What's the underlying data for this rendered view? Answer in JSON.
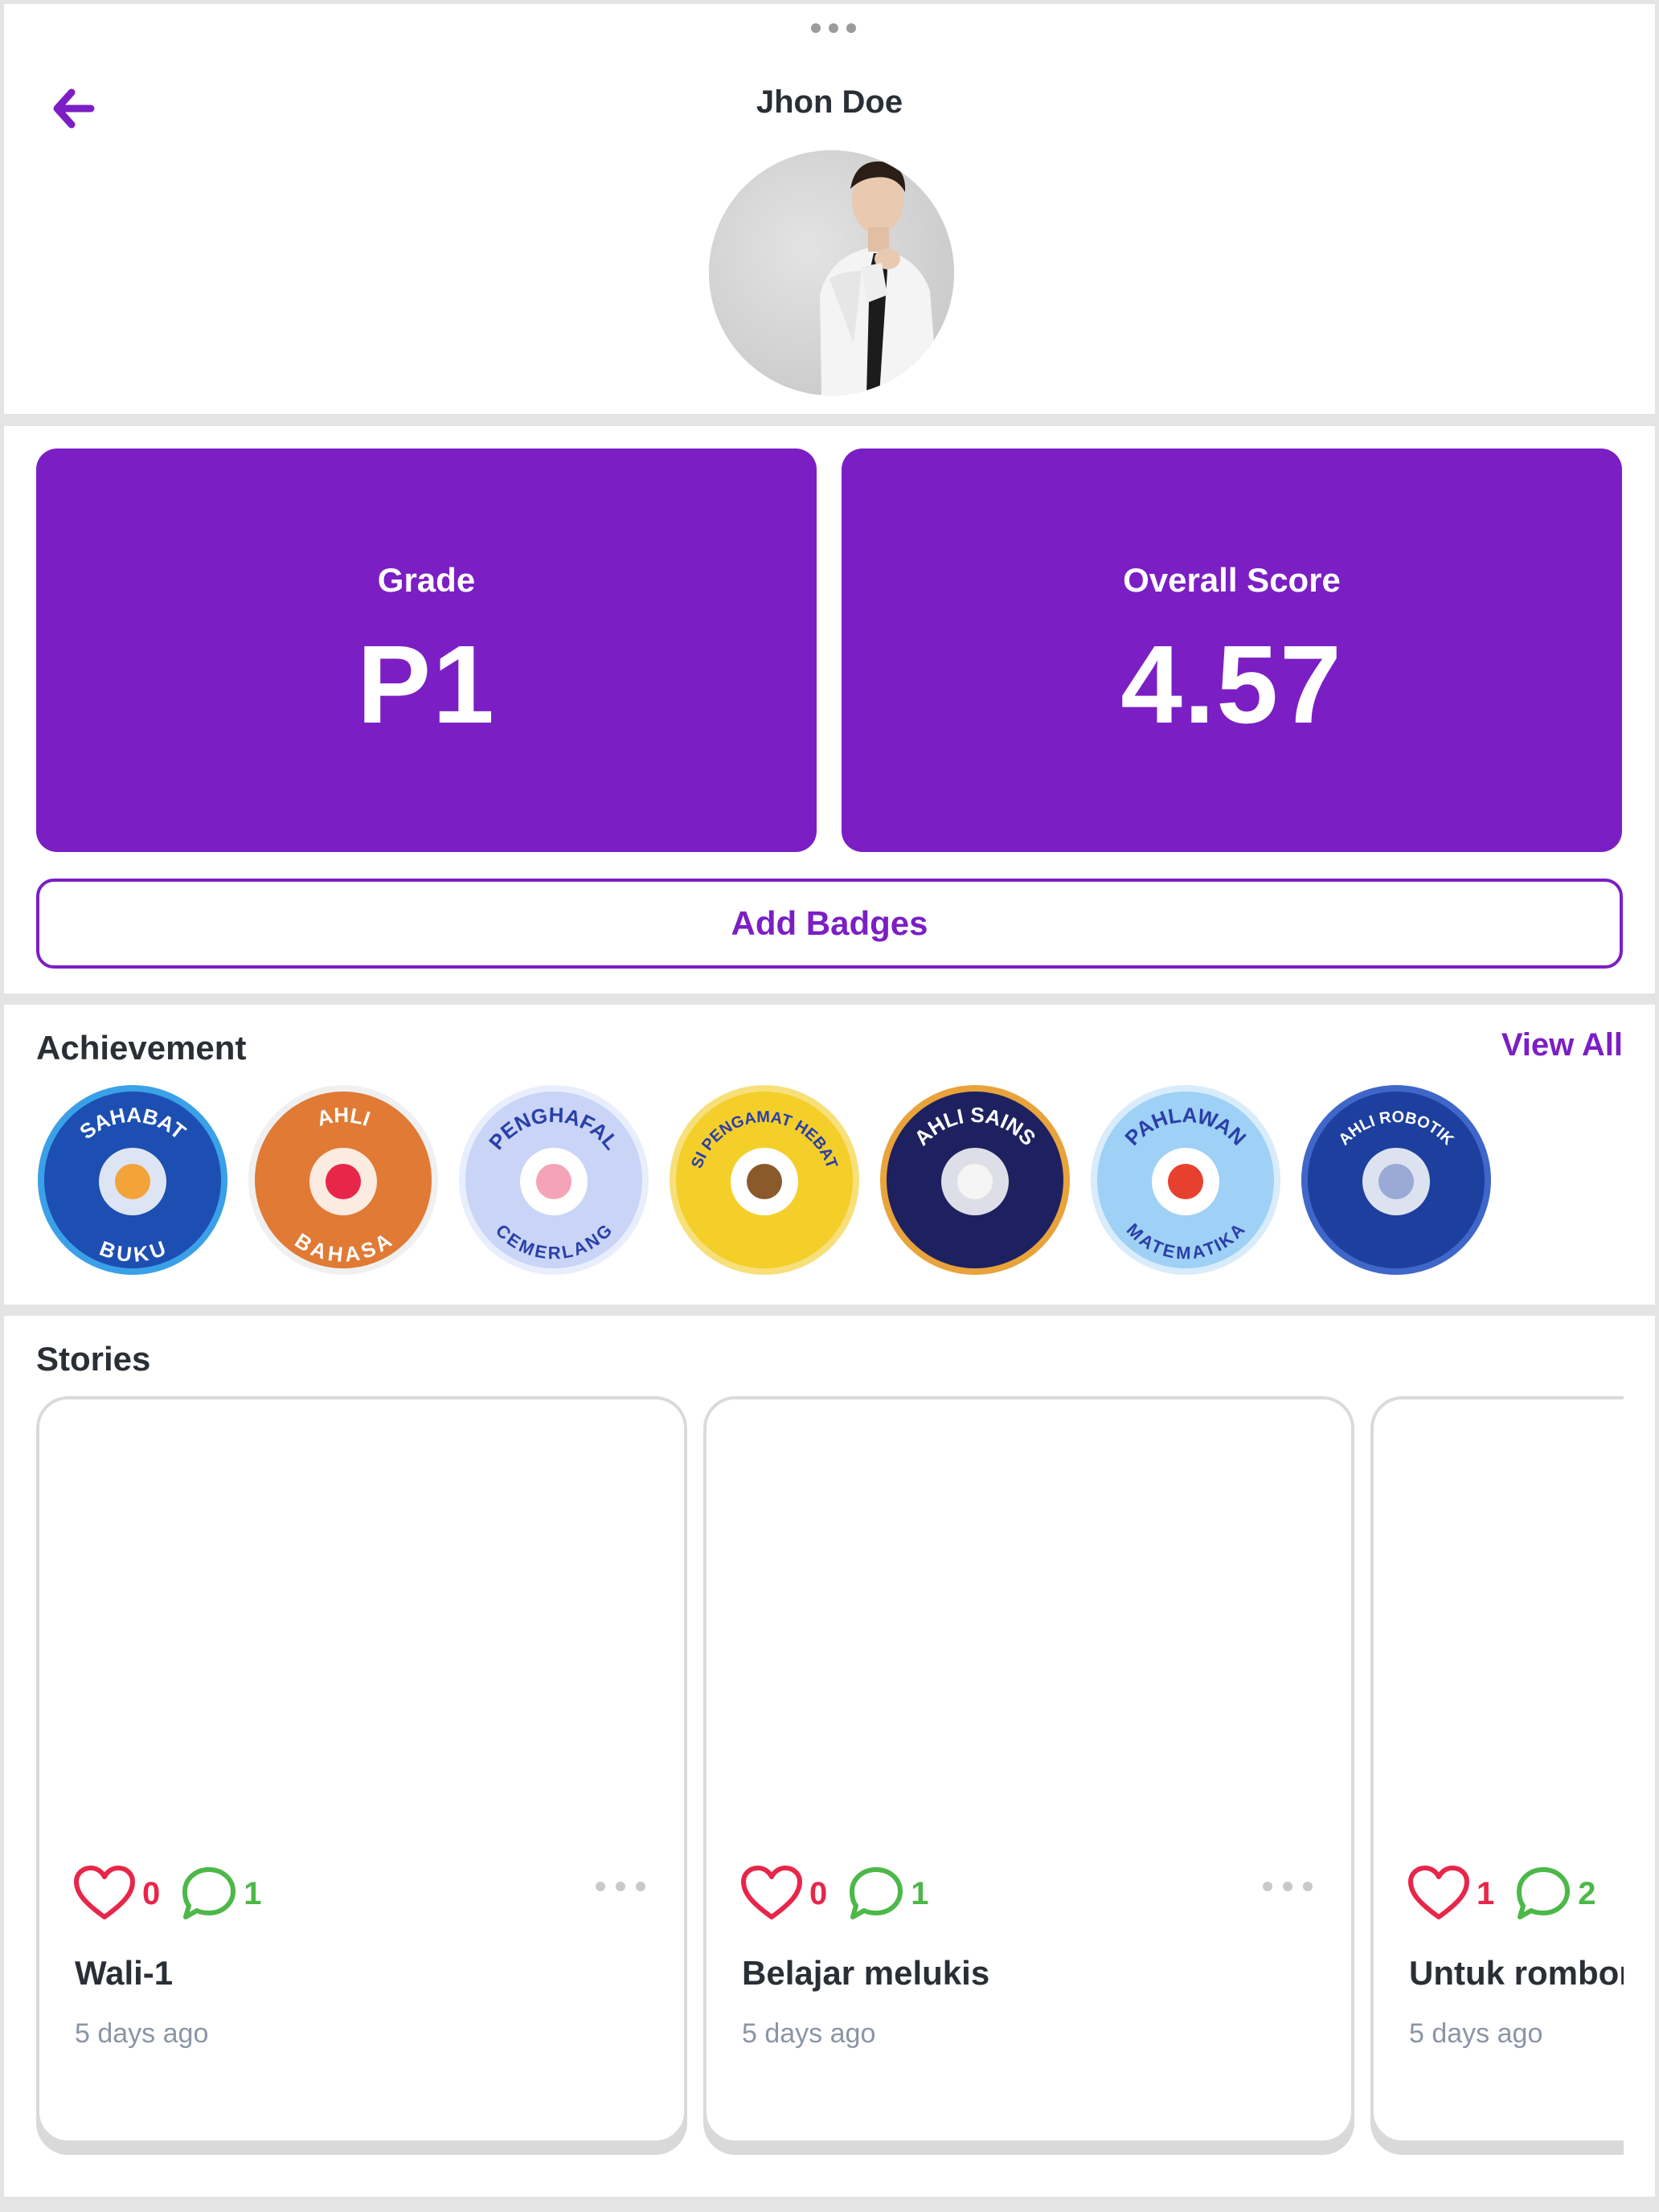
{
  "header": {
    "name": "Jhon Doe"
  },
  "stats": {
    "grade_label": "Grade",
    "grade_value": "P1",
    "score_label": "Overall Score",
    "score_value": "4.57",
    "add_badges_label": "Add Badges"
  },
  "achievement": {
    "title": "Achievement",
    "view_all": "View All",
    "badges": [
      {
        "top": "SAHABAT",
        "bottom": "BUKU",
        "bg": "#1d4fb3",
        "ring": "#3aa0e8"
      },
      {
        "top": "AHLI",
        "bottom": "BAHASA",
        "bg": "#e07a35",
        "ring": "#f0f0f0"
      },
      {
        "top": "PENGHAFAL",
        "bottom": "CEMERLANG",
        "bg": "#c9d4f7",
        "ring": "#e9eefc"
      },
      {
        "top": "SI PENGAMAT HEBAT",
        "bottom": "",
        "bg": "#f4cf2a",
        "ring": "#f7e07a"
      },
      {
        "top": "AHLI SAINS",
        "bottom": "",
        "bg": "#1e2160",
        "ring": "#e8a33b"
      },
      {
        "top": "PAHLAWAN",
        "bottom": "MATEMATIKA",
        "bg": "#9fd0f5",
        "ring": "#d8ecfb"
      },
      {
        "top": "AHLI ROBOTIK",
        "bottom": "",
        "bg": "#1d3f9e",
        "ring": "#3f67c9"
      }
    ]
  },
  "stories": {
    "title": "Stories",
    "items": [
      {
        "likes": "0",
        "comments": "1",
        "title": "Wali-1",
        "time": "5 days ago"
      },
      {
        "likes": "0",
        "comments": "1",
        "title": "Belajar melukis",
        "time": "5 days ago"
      },
      {
        "likes": "1",
        "comments": "2",
        "title": "Untuk rombongan",
        "time": "5 days ago"
      }
    ]
  },
  "colors": {
    "accent": "#7b1fc4",
    "like": "#e8264a",
    "comment": "#4cb848",
    "text_dark": "#2a2f36",
    "text_muted": "#8b95a5"
  }
}
